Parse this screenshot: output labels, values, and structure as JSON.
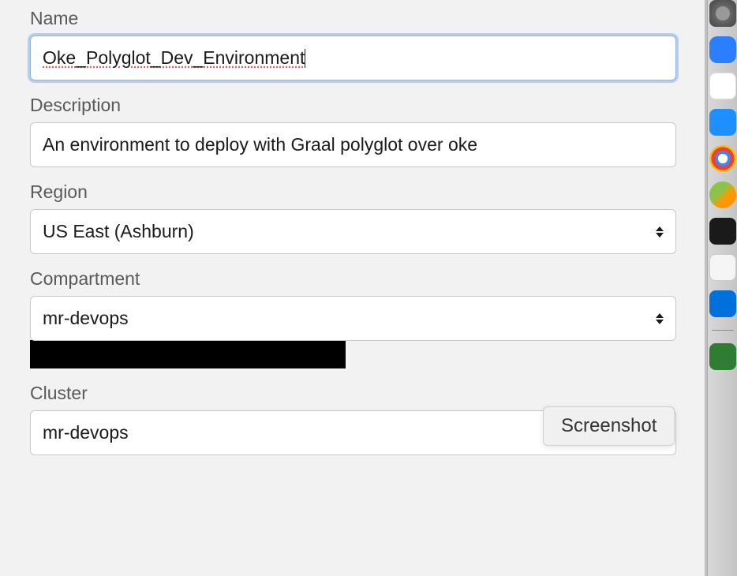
{
  "form": {
    "name": {
      "label": "Name",
      "value": "Oke_Polyglot_Dev_Environment"
    },
    "description": {
      "label": "Description",
      "value": "An environment to deploy with Graal polyglot over oke"
    },
    "region": {
      "label": "Region",
      "value": "US East (Ashburn)"
    },
    "compartment": {
      "label": "Compartment",
      "value": "mr-devops"
    },
    "cluster": {
      "label": "Cluster",
      "value": "mr-devops"
    }
  },
  "tooltip": {
    "text": "Screenshot"
  }
}
